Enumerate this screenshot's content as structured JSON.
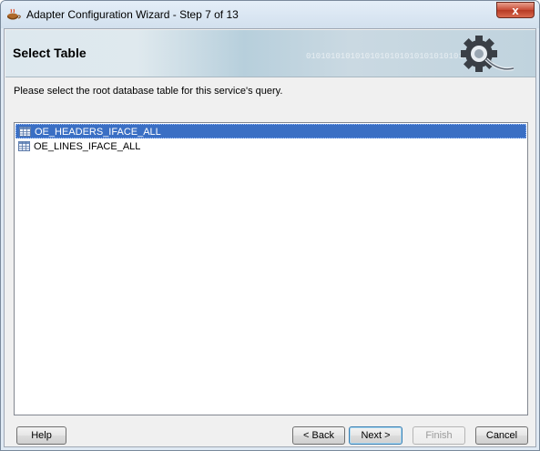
{
  "window": {
    "title": "Adapter Configuration Wizard - Step 7 of 13",
    "close_glyph": "x"
  },
  "banner": {
    "title": "Select Table",
    "decor_bits": "0101010101010101010101010101010101"
  },
  "instruction": "Please select the root database table for this service's query.",
  "tables": [
    {
      "name": "OE_HEADERS_IFACE_ALL",
      "selected": true
    },
    {
      "name": "OE_LINES_IFACE_ALL",
      "selected": false
    }
  ],
  "buttons": {
    "help": "Help",
    "back": "< Back",
    "next": "Next >",
    "finish": "Finish",
    "cancel": "Cancel"
  },
  "colors": {
    "selection": "#3a6fc4",
    "close": "#c74a34"
  },
  "icons": {
    "app": "coffee-cup-icon",
    "banner": "gear-plug-icon",
    "table": "table-grid-icon"
  }
}
